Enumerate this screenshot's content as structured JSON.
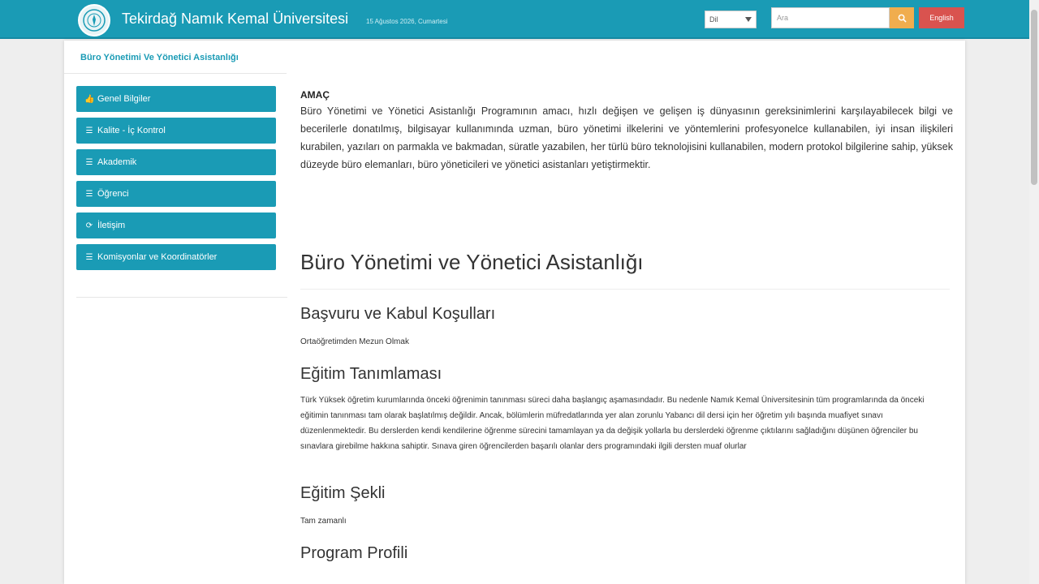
{
  "header": {
    "site_title": "Tekirdağ Namık Kemal Üniversitesi",
    "date_text": "15 Ağustos 2026, Cumartesi",
    "language_select": "Dil",
    "search_placeholder": "Ara",
    "english_button": "English",
    "icons": {
      "logo": "university-seal",
      "search": "search-icon",
      "dropdown": "chevron-down-icon"
    },
    "colors": {
      "topbar": "#1a9bb5",
      "search_button": "#f0ad4e",
      "english_button": "#d9534f"
    }
  },
  "sidebar": {
    "department_title": "Büro Yönetimi Ve Yönetici Asistanlığı",
    "items": [
      {
        "label": "Genel Bilgiler",
        "icon": "thumbs-up-icon",
        "glyph": "👍"
      },
      {
        "label": "Kalite - İç Kontrol",
        "icon": "list-icon",
        "glyph": "☰"
      },
      {
        "label": "Akademik",
        "icon": "list-icon",
        "glyph": "☰"
      },
      {
        "label": "Öğrenci",
        "icon": "list-icon",
        "glyph": "☰"
      },
      {
        "label": "İletişim",
        "icon": "refresh-icon",
        "glyph": "⟳"
      },
      {
        "label": "Komisyonlar ve Koordinatörler",
        "icon": "list-icon",
        "glyph": "☰"
      }
    ]
  },
  "content": {
    "purpose_title": "AMAÇ",
    "purpose_text": "Büro Yönetimi ve Yönetici Asistanlığı Programının amacı, hızlı değişen ve gelişen iş dünyasının gereksinimlerini karşılayabilecek bilgi ve becerilerle donatılmış, bilgisayar kullanımında uzman, büro yönetimi ilkelerini ve yöntemlerini profesyonelce kullanabilen, iyi insan ilişkileri kurabilen, yazıları on parmakla ve bakmadan, süratle yazabilen, her türlü büro teknolojisini kullanabilen, modern protokol bilgilerine sahip, yüksek düzeyde büro elemanları, büro yöneticileri ve yönetici asistanları yetiştirmektir.",
    "program_title": "Büro Yönetimi ve Yönetici Asistanlığı",
    "sections": [
      {
        "title": "Başvuru ve Kabul Koşulları",
        "text": "Ortaöğretimden Mezun Olmak"
      },
      {
        "title": "Eğitim Tanımlaması",
        "text": "Türk Yüksek öğretim kurumlarında önceki öğrenimin tanınması süreci daha başlangıç aşamasındadır. Bu nedenle Namık Kemal Üniversitesinin tüm programlarında da önceki eğitimin tanınması tam olarak başlatılmış değildir. Ancak, bölümlerin müfredatlarında yer alan zorunlu Yabancı dil dersi için her öğretim yılı başında muafiyet sınavı düzenlenmektedir. Bu derslerden kendi kendilerine öğrenme sürecini tamamlayan ya da değişik yollarla bu derslerdeki öğrenme çıktılarını sağladığını düşünen öğrenciler bu sınavlara girebilme hakkına sahiptir. Sınava giren öğrencilerden başarılı olanlar ders programındaki ilgili dersten muaf olurlar"
      },
      {
        "title": "Eğitim Şekli",
        "text": "Tam zamanlı"
      },
      {
        "title": "Program Profili",
        "text": ""
      }
    ]
  }
}
